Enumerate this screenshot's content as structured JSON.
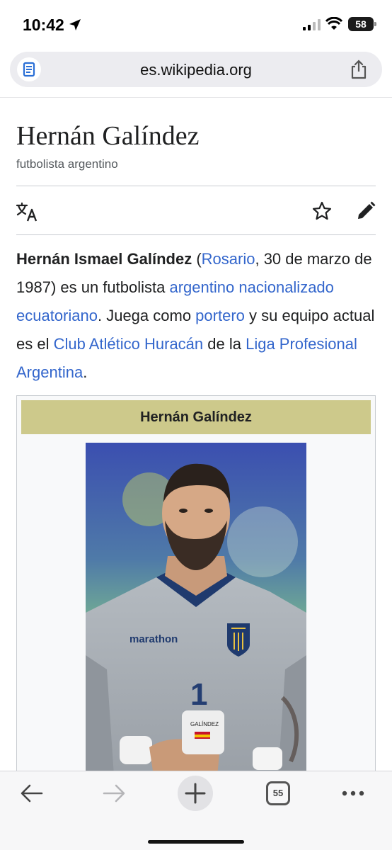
{
  "status_bar": {
    "time": "10:42",
    "battery": "58",
    "icons": [
      "location-arrow-icon",
      "signal-bars-icon",
      "wifi-icon",
      "battery-icon"
    ]
  },
  "browser": {
    "url": "es.wikipedia.org",
    "tab_count": "55",
    "icons": [
      "reader-mode-icon",
      "share-icon",
      "back-arrow-icon",
      "forward-arrow-icon",
      "new-tab-plus-icon",
      "tabs-icon",
      "more-dots-icon"
    ]
  },
  "article": {
    "title": "Hernán Galíndez",
    "subtitle": "futbolista argentino",
    "action_icons": [
      "translate-icon",
      "star-icon",
      "edit-pencil-icon"
    ],
    "lead": {
      "name": "Hernán Ismael Galíndez",
      "open_paren": " (",
      "link_rosario": "Rosario",
      "t1": ", 30 de marzo de 1987) es un futbolista ",
      "link_argentino": "argentino",
      "t2": " ",
      "link_nacionalizado": "nacionalizado ecuatoriano",
      "t3": ". Juega como ",
      "link_portero": "portero",
      "t4": " y su equipo actual es el ",
      "link_club": "Club Atlético Huracán",
      "t5": " de la ",
      "link_liga": "Liga Profesional Argentina",
      "t6": "."
    },
    "infobox": {
      "header": "Hernán Galíndez",
      "photo": {
        "jersey_brand": "marathon",
        "jersey_number": "1",
        "tape_text": "GALÍNDEZ"
      }
    }
  },
  "colors": {
    "link": "#3366cc",
    "infobox_header": "#cdc98b",
    "text": "#202122"
  }
}
